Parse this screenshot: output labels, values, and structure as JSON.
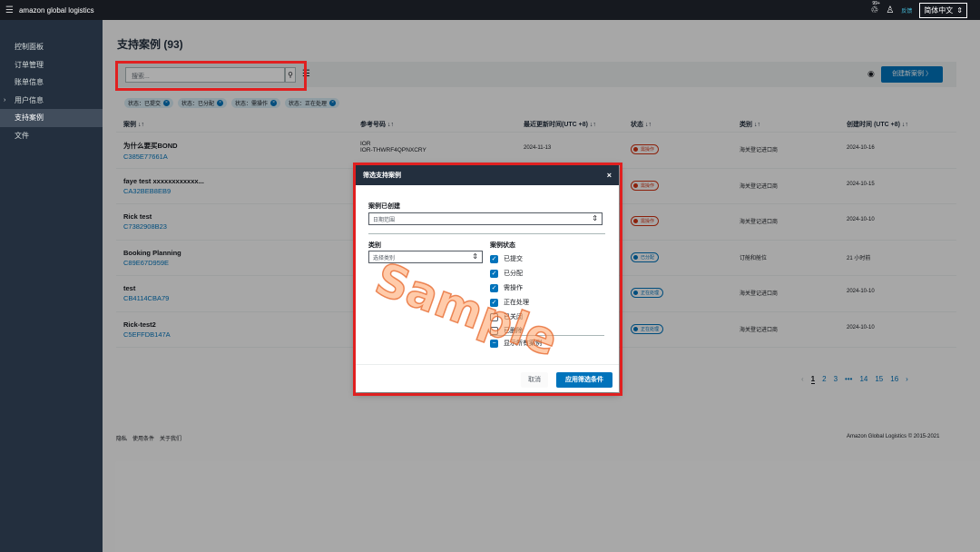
{
  "topbar": {
    "brand": "amazon global logistics",
    "badge": "99+",
    "feedback": "反馈",
    "language": "简体中文"
  },
  "sidebar": {
    "items": [
      {
        "label": "控制面板"
      },
      {
        "label": "订单管理"
      },
      {
        "label": "账单信息"
      },
      {
        "label": "用户信息"
      },
      {
        "label": "支持案例"
      },
      {
        "label": "文件"
      }
    ]
  },
  "main": {
    "title": "支持案例 (93)",
    "search_placeholder": "搜索...",
    "create_button": "创建新案例 〉",
    "chips": [
      "状态：已提交",
      "状态：已分配",
      "状态：需操作",
      "状态：正在处理"
    ],
    "columns": [
      "案例 ↓↑",
      "参考号码 ↓↑",
      "最近更新时间(UTC +8) ↓↑",
      "状态 ↓↑",
      "类别 ↓↑",
      "创建时间 (UTC +8) ↓↑"
    ],
    "rows": [
      {
        "title": "为什么要买BOND",
        "id": "C385E77661A",
        "ref1": "IOR",
        "ref2": "IOR-THWRF4QPNXCRY",
        "updated": "2024-11-13",
        "status": "需操作",
        "category": "海关登记进口商",
        "created": "2024-10-16"
      },
      {
        "title": "faye test xxxxxxxxxxxx...",
        "id": "CA32BEB8EB9",
        "ref1": "",
        "ref2": "",
        "updated": "",
        "status": "需操作",
        "category": "海关登记进口商",
        "created": "2024-10-15"
      },
      {
        "title": "Rick test",
        "id": "C7382908B23",
        "ref1": "",
        "ref2": "",
        "updated": "",
        "status": "需操作",
        "category": "海关登记进口商",
        "created": "2024-10-10"
      },
      {
        "title": "Booking Planning",
        "id": "C89E67D959E",
        "ref1": "",
        "ref2": "",
        "updated": "",
        "status": "已分配",
        "category": "订舱和舱位",
        "created": "21 小时前"
      },
      {
        "title": "test",
        "id": "CB4114CBA79",
        "ref1": "",
        "ref2": "",
        "updated": "",
        "status": "正在处理",
        "category": "海关登记进口商",
        "created": "2024-10-10"
      },
      {
        "title": "Rick-test2",
        "id": "C5EFFDB147A",
        "ref1": "",
        "ref2": "",
        "updated": "",
        "status": "正在处理",
        "category": "海关登记进口商",
        "created": "2024-10-10"
      }
    ],
    "pager": {
      "prev": "‹",
      "pages": [
        "1",
        "2",
        "3",
        "•••",
        "14",
        "15",
        "16"
      ],
      "next": "›"
    },
    "footer_links": [
      "隐私",
      "使用条件",
      "关于我们"
    ],
    "copyright": "Amazon Global Logistics © 2015-2021"
  },
  "modal": {
    "title": "筛选支持案例",
    "close": "×",
    "created_label": "案例已创建",
    "created_value": "日期范围",
    "category_label": "类别",
    "category_value": "选择类别",
    "status_label": "案例状态",
    "status_options": [
      {
        "label": "已提交",
        "checked": true
      },
      {
        "label": "已分配",
        "checked": true
      },
      {
        "label": "需操作",
        "checked": true
      },
      {
        "label": "正在处理",
        "checked": true
      },
      {
        "label": "已关闭",
        "checked": false
      },
      {
        "label": "已删除",
        "checked": false
      }
    ],
    "show_all": "显示所有案例",
    "cancel": "取消",
    "apply": "应用筛选条件"
  },
  "watermark": "Sample",
  "colors": {
    "accent": "#0073bb",
    "highlight": "#e02020",
    "dark": "#16191f"
  }
}
